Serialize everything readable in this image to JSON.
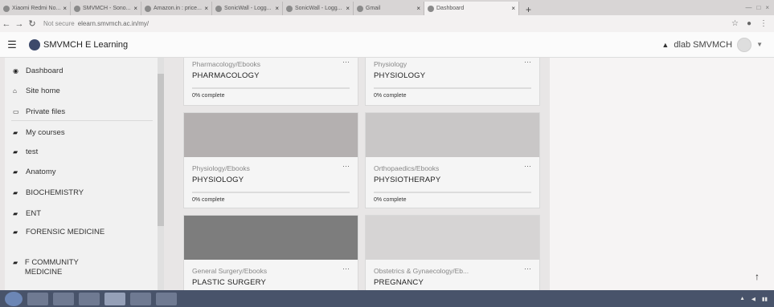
{
  "browser": {
    "tabs": [
      {
        "title": "Xiaomi Redmi No..."
      },
      {
        "title": "SMVMCH - Sono..."
      },
      {
        "title": "Amazon.in : price..."
      },
      {
        "title": "SonicWall - Logg..."
      },
      {
        "title": "SonicWall - Logg..."
      },
      {
        "title": "Gmail"
      },
      {
        "title": "Dashboard",
        "active": true
      }
    ],
    "new_tab": "+",
    "address": {
      "security": "Not secure",
      "url": "elearn.smvmch.ac.in/my/"
    }
  },
  "header": {
    "menu_icon": "☰",
    "brand": "SMVMCH E Learning",
    "user_name": "dlab SMVMCH"
  },
  "sidebar": {
    "items": [
      {
        "icon": "tachometer-icon",
        "label": "Dashboard"
      },
      {
        "icon": "home-icon",
        "label": "Site home"
      },
      {
        "icon": "file-icon",
        "label": "Private files"
      },
      {
        "icon": "graduation-cap-icon",
        "label": "My courses"
      },
      {
        "icon": "graduation-cap-icon",
        "label": "test"
      },
      {
        "icon": "graduation-cap-icon",
        "label": "Anatomy"
      },
      {
        "icon": "graduation-cap-icon",
        "label": "BIOCHEMISTRY"
      },
      {
        "icon": "graduation-cap-icon",
        "label": "ENT"
      },
      {
        "icon": "graduation-cap-icon",
        "label": "FORENSIC MEDICINE"
      },
      {
        "icon": "graduation-cap-icon",
        "label": "F COMMUNITY MEDICINE"
      }
    ]
  },
  "courses": [
    {
      "category": "Pharmacology/Ebooks",
      "name": "PHARMACOLOGY",
      "progress": "0% complete",
      "menu": "···"
    },
    {
      "category": "Physiology",
      "name": "PHYSIOLOGY",
      "progress": "0% complete",
      "menu": "···"
    },
    {
      "category": "Physiology/Ebooks",
      "name": "PHYSIOLOGY",
      "progress": "0% complete",
      "menu": "···"
    },
    {
      "category": "Orthopaedics/Ebooks",
      "name": "PHYSIOTHERAPY",
      "progress": "0% complete",
      "menu": "···"
    },
    {
      "category": "General Surgery/Ebooks",
      "name": "PLASTIC SURGERY",
      "menu": "···"
    },
    {
      "category": "Obstetrics & Gynaecology/Eb...",
      "name": "PREGNANCY",
      "menu": "···"
    }
  ],
  "colors": {
    "taskbar": "#48536a",
    "card_img_1": "#b4b0b0",
    "card_img_2": "#c9c7c7",
    "card_img_3": "#7d7d7d",
    "card_img_4": "#d6d4d4"
  },
  "scroll_top_icon": "↑"
}
